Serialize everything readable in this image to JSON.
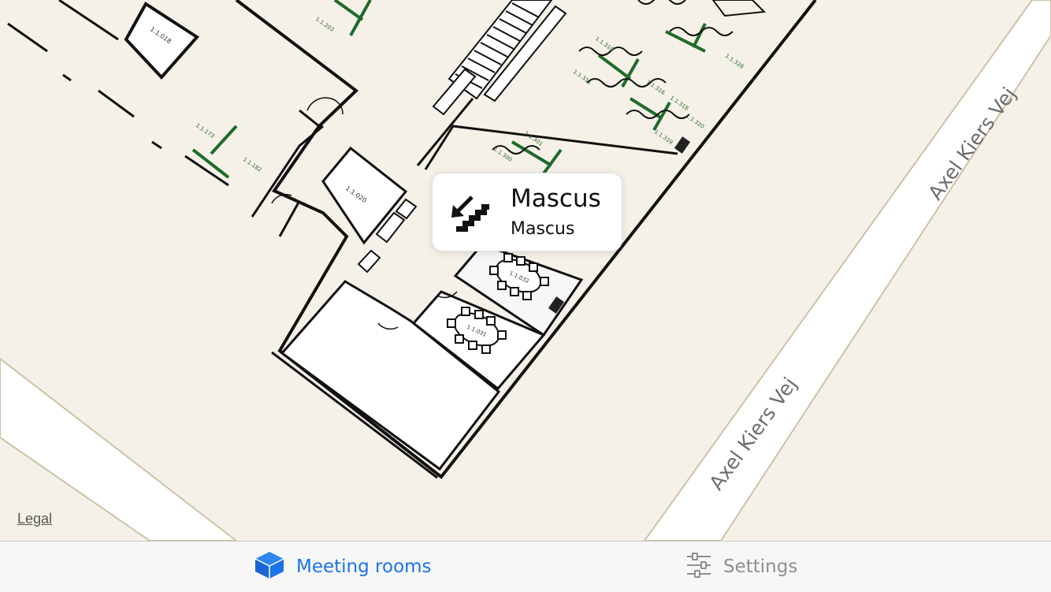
{
  "map": {
    "street_labels": [
      "Axel Kiers Vej",
      "Axel Kiers Vej"
    ],
    "legal_label": "Legal",
    "colors": {
      "background": "#f5f1e8",
      "road": "#ffffff",
      "road_edge": "#cfc2a6",
      "wall": "#111111"
    }
  },
  "callout": {
    "icon": "stairs-down-icon",
    "title": "Mascus",
    "subtitle": "Mascus"
  },
  "tabbar": {
    "tabs": [
      {
        "label": "Meeting rooms",
        "icon": "cube-icon",
        "selected": true,
        "color": "#1a73e8"
      },
      {
        "label": "Settings",
        "icon": "sliders-icon",
        "selected": false,
        "color": "#8e8e93"
      }
    ]
  }
}
